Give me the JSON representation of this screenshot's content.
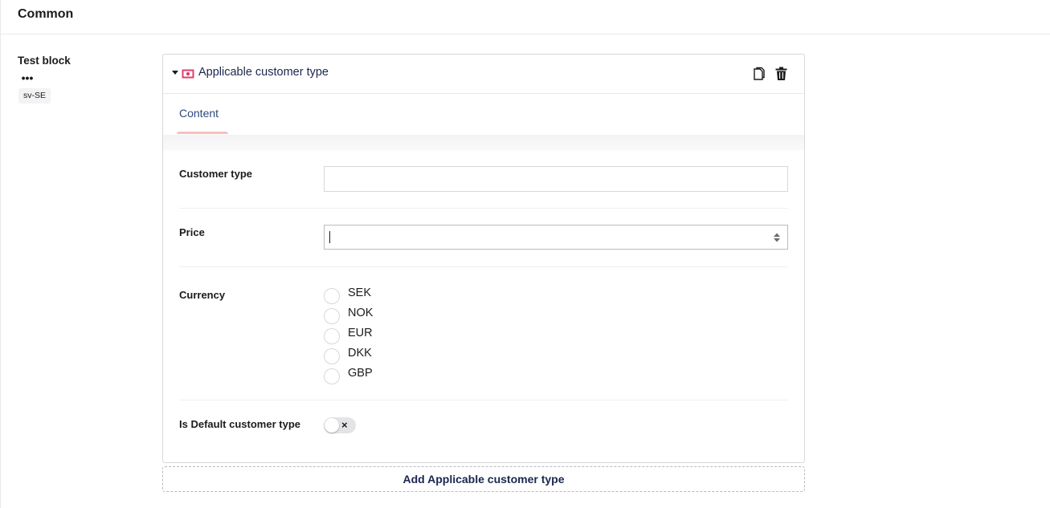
{
  "group": {
    "title": "Common"
  },
  "property": {
    "label": "Test block",
    "actions_label": "•••",
    "culture": "sv-SE"
  },
  "block": {
    "title": "Applicable customer type",
    "icon_color": "#e33c6a",
    "tabs": [
      {
        "label": "Content",
        "active": true
      }
    ],
    "fields": {
      "customer_type": {
        "label": "Customer type",
        "value": ""
      },
      "price": {
        "label": "Price",
        "value": ""
      },
      "currency": {
        "label": "Currency",
        "options": [
          "SEK",
          "NOK",
          "EUR",
          "DKK",
          "GBP"
        ],
        "selected": null
      },
      "is_default": {
        "label": "Is Default customer type",
        "toggle_symbol": "×",
        "on": false
      }
    }
  },
  "add_button": {
    "label": "Add Applicable customer type"
  },
  "colors": {
    "text_dark": "#1b264f",
    "border": "#d8d7d9",
    "tab_underline": "#f5c1bc"
  }
}
